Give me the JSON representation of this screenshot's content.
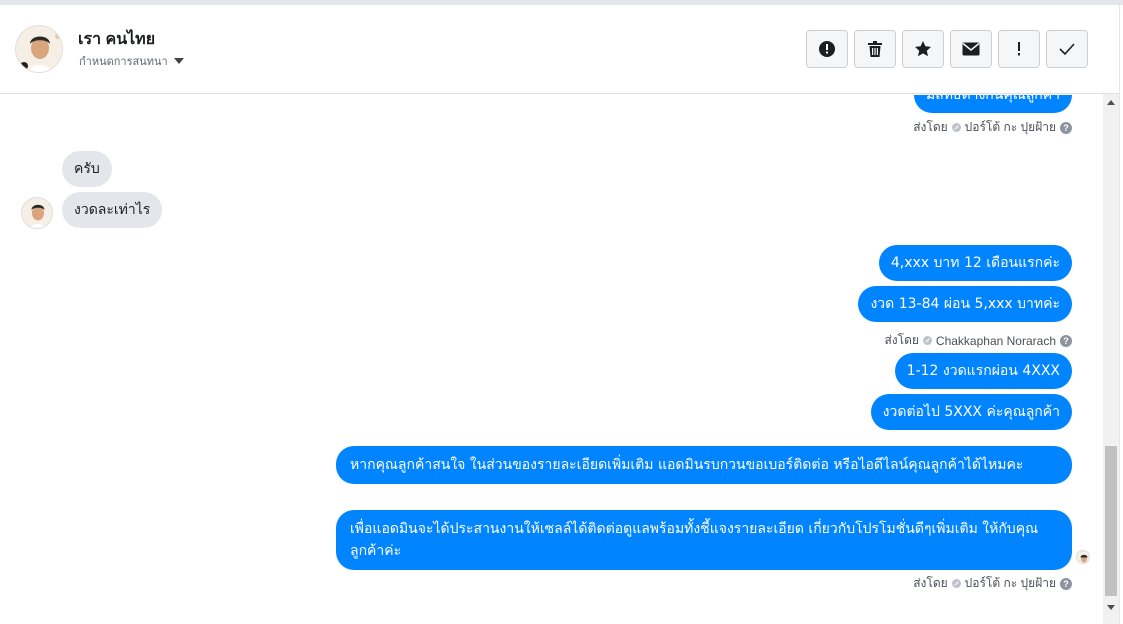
{
  "conversation": {
    "contact_name": "เรา คนไทย",
    "assign_label": "กำหนดการสนทนา",
    "icons": {
      "avatar": "user-avatar-icon",
      "assign_caret": "caret-down-icon"
    }
  },
  "toolbar": {
    "buttons": [
      {
        "name": "spam-button",
        "icon": "alert-circle-icon"
      },
      {
        "name": "delete-button",
        "icon": "trash-icon"
      },
      {
        "name": "star-button",
        "icon": "star-icon"
      },
      {
        "name": "mark-unread-button",
        "icon": "envelope-icon"
      },
      {
        "name": "important-button",
        "icon": "exclamation-icon"
      },
      {
        "name": "done-button",
        "icon": "check-icon"
      }
    ]
  },
  "messages": {
    "top_partial": "มีสิทธิ์ต่างกันคุณลูกค้า",
    "sent_by_1": {
      "prefix": "ส่งโดย",
      "agent": "ปอร์โต้ กะ ปุยฝ้าย"
    },
    "incoming": [
      "ครับ",
      "งวดละเท่าไร"
    ],
    "group_1": [
      "4,xxx บาท 12 เดือนแรกค่ะ",
      "งวด 13-84 ผ่อน 5,xxx บาทค่ะ"
    ],
    "sent_by_2": {
      "prefix": "ส่งโดย",
      "agent": "Chakkaphan Norarach"
    },
    "group_2": [
      "1-12 งวดแรกผ่อน 4XXX",
      "งวดต่อไป 5XXX ค่ะคุณลูกค้า"
    ],
    "group_3": [
      "หากคุณลูกค้าสนใจ ในส่วนของรายละเอียดเพิ่มเติม แอดมินรบกวนขอเบอร์ติดต่อ หรือไอดีไลน์คุณลูกค้าได้ไหมคะ",
      "เพื่อแอดมินจะได้ประสานงานให้เซลล์ได้ติดต่อดูแลพร้อมทั้งชี้แจงรายละเอียด เกี่ยวกับโปรโมชั่นดีๆเพิ่มเติม ให้กับคุณลูกค้าค่ะ"
    ],
    "sent_by_3": {
      "prefix": "ส่งโดย",
      "agent": "ปอร์โต้ กะ ปุยฝ้าย"
    }
  },
  "colors": {
    "outgoing_bubble": "#0084ff",
    "incoming_bubble": "#e4e6eb"
  }
}
